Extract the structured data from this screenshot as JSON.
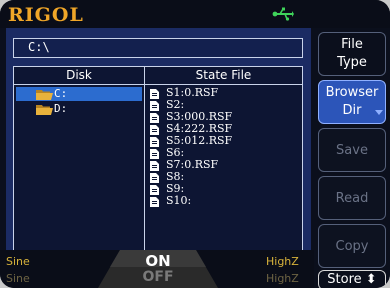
{
  "brand": "RIGOL",
  "path": "C:\\",
  "columns": {
    "disk": "Disk",
    "state": "State File"
  },
  "disks": [
    {
      "label": "C:",
      "selected": true
    },
    {
      "label": "D:",
      "selected": false
    }
  ],
  "files": [
    "S1:0.RSF",
    "S2:",
    "S3:000.RSF",
    "S4:222.RSF",
    "S5:012.RSF",
    "S6:",
    "S7:0.RSF",
    "S8:",
    "S9:",
    "S10:"
  ],
  "softkeys": {
    "filetype": {
      "l1": "File",
      "l2": "Type"
    },
    "browser": {
      "l1": "Browser",
      "l2": "Dir"
    },
    "save": "Save",
    "read": "Read",
    "copy": "Copy",
    "store": "Store"
  },
  "status": {
    "ch1_wave": "Sine",
    "ch2_wave": "Sine",
    "ch1_imp": "HighZ",
    "ch2_imp": "HighZ",
    "on": "ON",
    "off": "OFF"
  },
  "colors": {
    "brand": "#f0a628",
    "panel": "#1b2b63",
    "selection": "#2c6ccf",
    "accent": "#d8b33b"
  }
}
